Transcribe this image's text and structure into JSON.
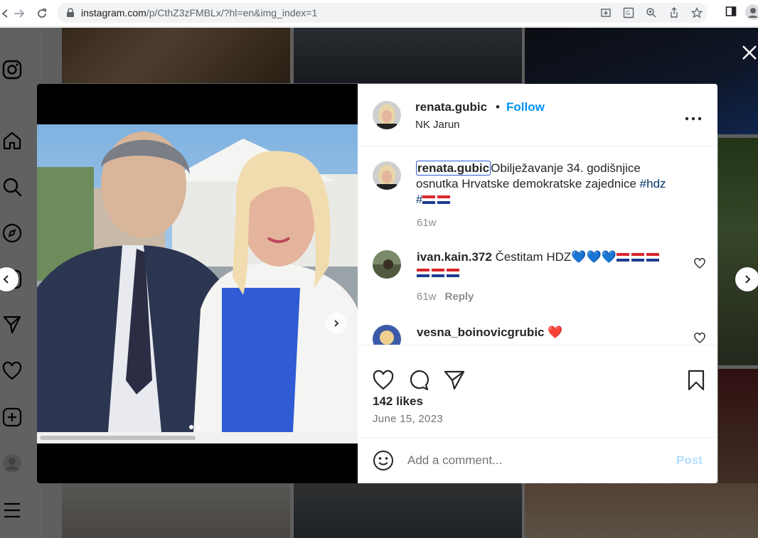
{
  "browser": {
    "url_domain": "instagram.com",
    "url_path": "/p/CthZ3zFMBLx/?hl=en&img_index=1"
  },
  "post": {
    "username": "renata.gubic",
    "separator": "•",
    "follow_label": "Follow",
    "location": "NK Jarun",
    "caption": {
      "username": "renata.gubic",
      "text": "Obilježavanje 34. godišnjice",
      "text_line2": "osnutka Hrvatske demokratske zajednice ",
      "hashtag": "#hdz",
      "hashtag2": "#",
      "time": "61w"
    },
    "comments": [
      {
        "username": "ivan.kain.372",
        "text": "Čestitam HDZ",
        "emoji": "💙💙💙",
        "time": "61w",
        "reply_label": "Reply"
      },
      {
        "username": "vesna_boinovicgrubic",
        "emoji": "❤️"
      }
    ],
    "likes": "142 likes",
    "date": "June 15, 2023",
    "comment_placeholder": "Add a comment...",
    "post_label": "Post"
  },
  "colors": {
    "link": "#0095f6",
    "hashtag": "#00376b",
    "post_disabled": "#b2dffc"
  },
  "icons": [
    "instagram-icon",
    "home-icon",
    "search-icon",
    "explore-icon",
    "reels-icon",
    "messages-icon",
    "notifications-icon",
    "create-icon",
    "profile-icon",
    "menu-icon",
    "close-icon",
    "more-icon",
    "heart-icon",
    "comment-icon",
    "share-icon",
    "save-icon",
    "emoji-icon"
  ]
}
